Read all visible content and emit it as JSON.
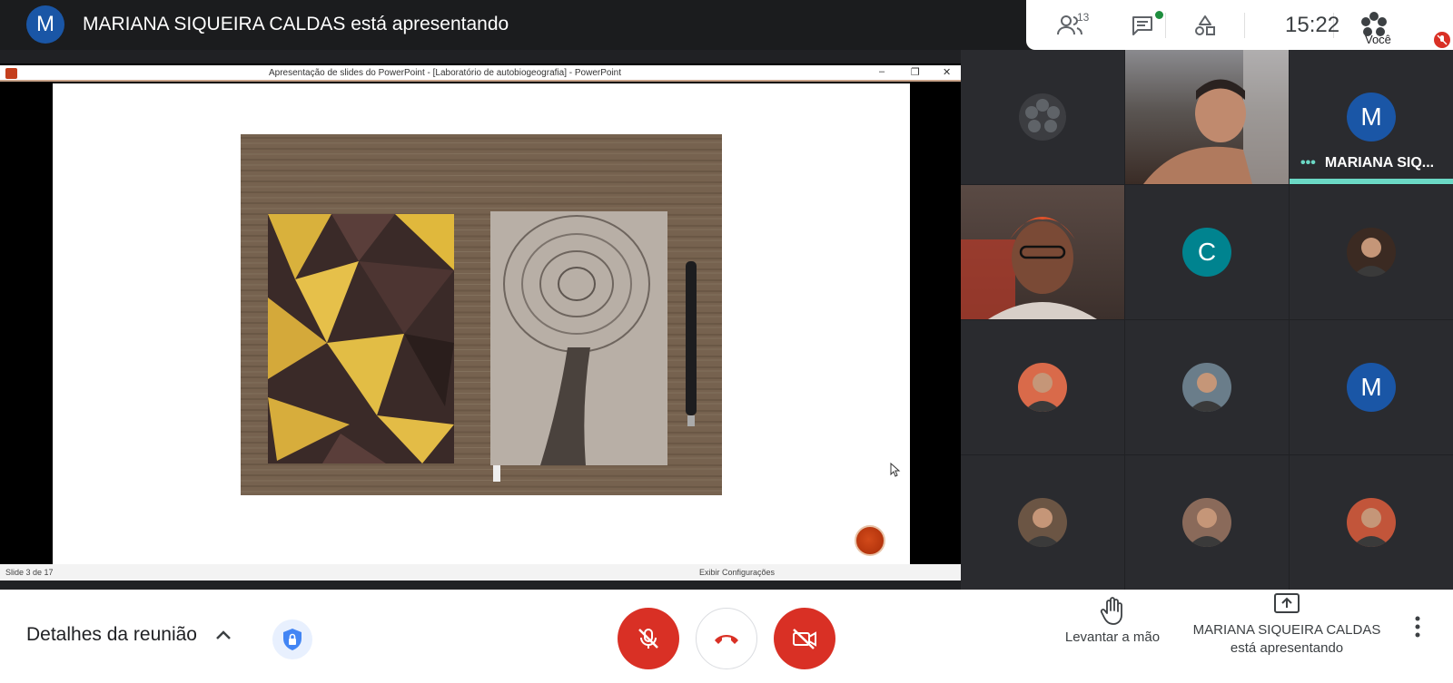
{
  "header": {
    "presenter_initial": "M",
    "presenter_text": "MARIANA SIQUEIRA CALDAS está apresentando",
    "participant_count": "13",
    "time": "15:22",
    "you_label": "Você"
  },
  "share": {
    "window_title": "Apresentação de slides do PowerPoint - [Laboratório de autobiogeografia] - PowerPoint",
    "slide_number": "Slide 3 de 17",
    "notes_label": "Exibir Configurações"
  },
  "participants": [
    {
      "kind": "logo"
    },
    {
      "kind": "video",
      "desc": "person-video"
    },
    {
      "kind": "initial",
      "initial": "M",
      "color": "#1a56a6",
      "name": "MARIANA SIQ...",
      "speaking": true
    },
    {
      "kind": "video",
      "desc": "person-video-2"
    },
    {
      "kind": "initial",
      "initial": "C",
      "color": "#00838f"
    },
    {
      "kind": "photo",
      "color": "#3b2a22"
    },
    {
      "kind": "photo",
      "color": "#d96a4a"
    },
    {
      "kind": "photo",
      "color": "#6a7d8a"
    },
    {
      "kind": "initial",
      "initial": "M",
      "color": "#1a56a6"
    },
    {
      "kind": "photo",
      "color": "#6b5544"
    },
    {
      "kind": "photo",
      "color": "#8a6a5a"
    },
    {
      "kind": "photo",
      "color": "#c2553a"
    }
  ],
  "bottom": {
    "details_label": "Detalhes da reunião",
    "raise_hand_label": "Levantar a mão",
    "presenting_label_line1": "MARIANA SIQUEIRA CALDAS",
    "presenting_label_line2": "está apresentando"
  },
  "colors": {
    "accent_red": "#d93025",
    "speaking": "#6bd8c5",
    "avatar_blue": "#1a56a6"
  }
}
